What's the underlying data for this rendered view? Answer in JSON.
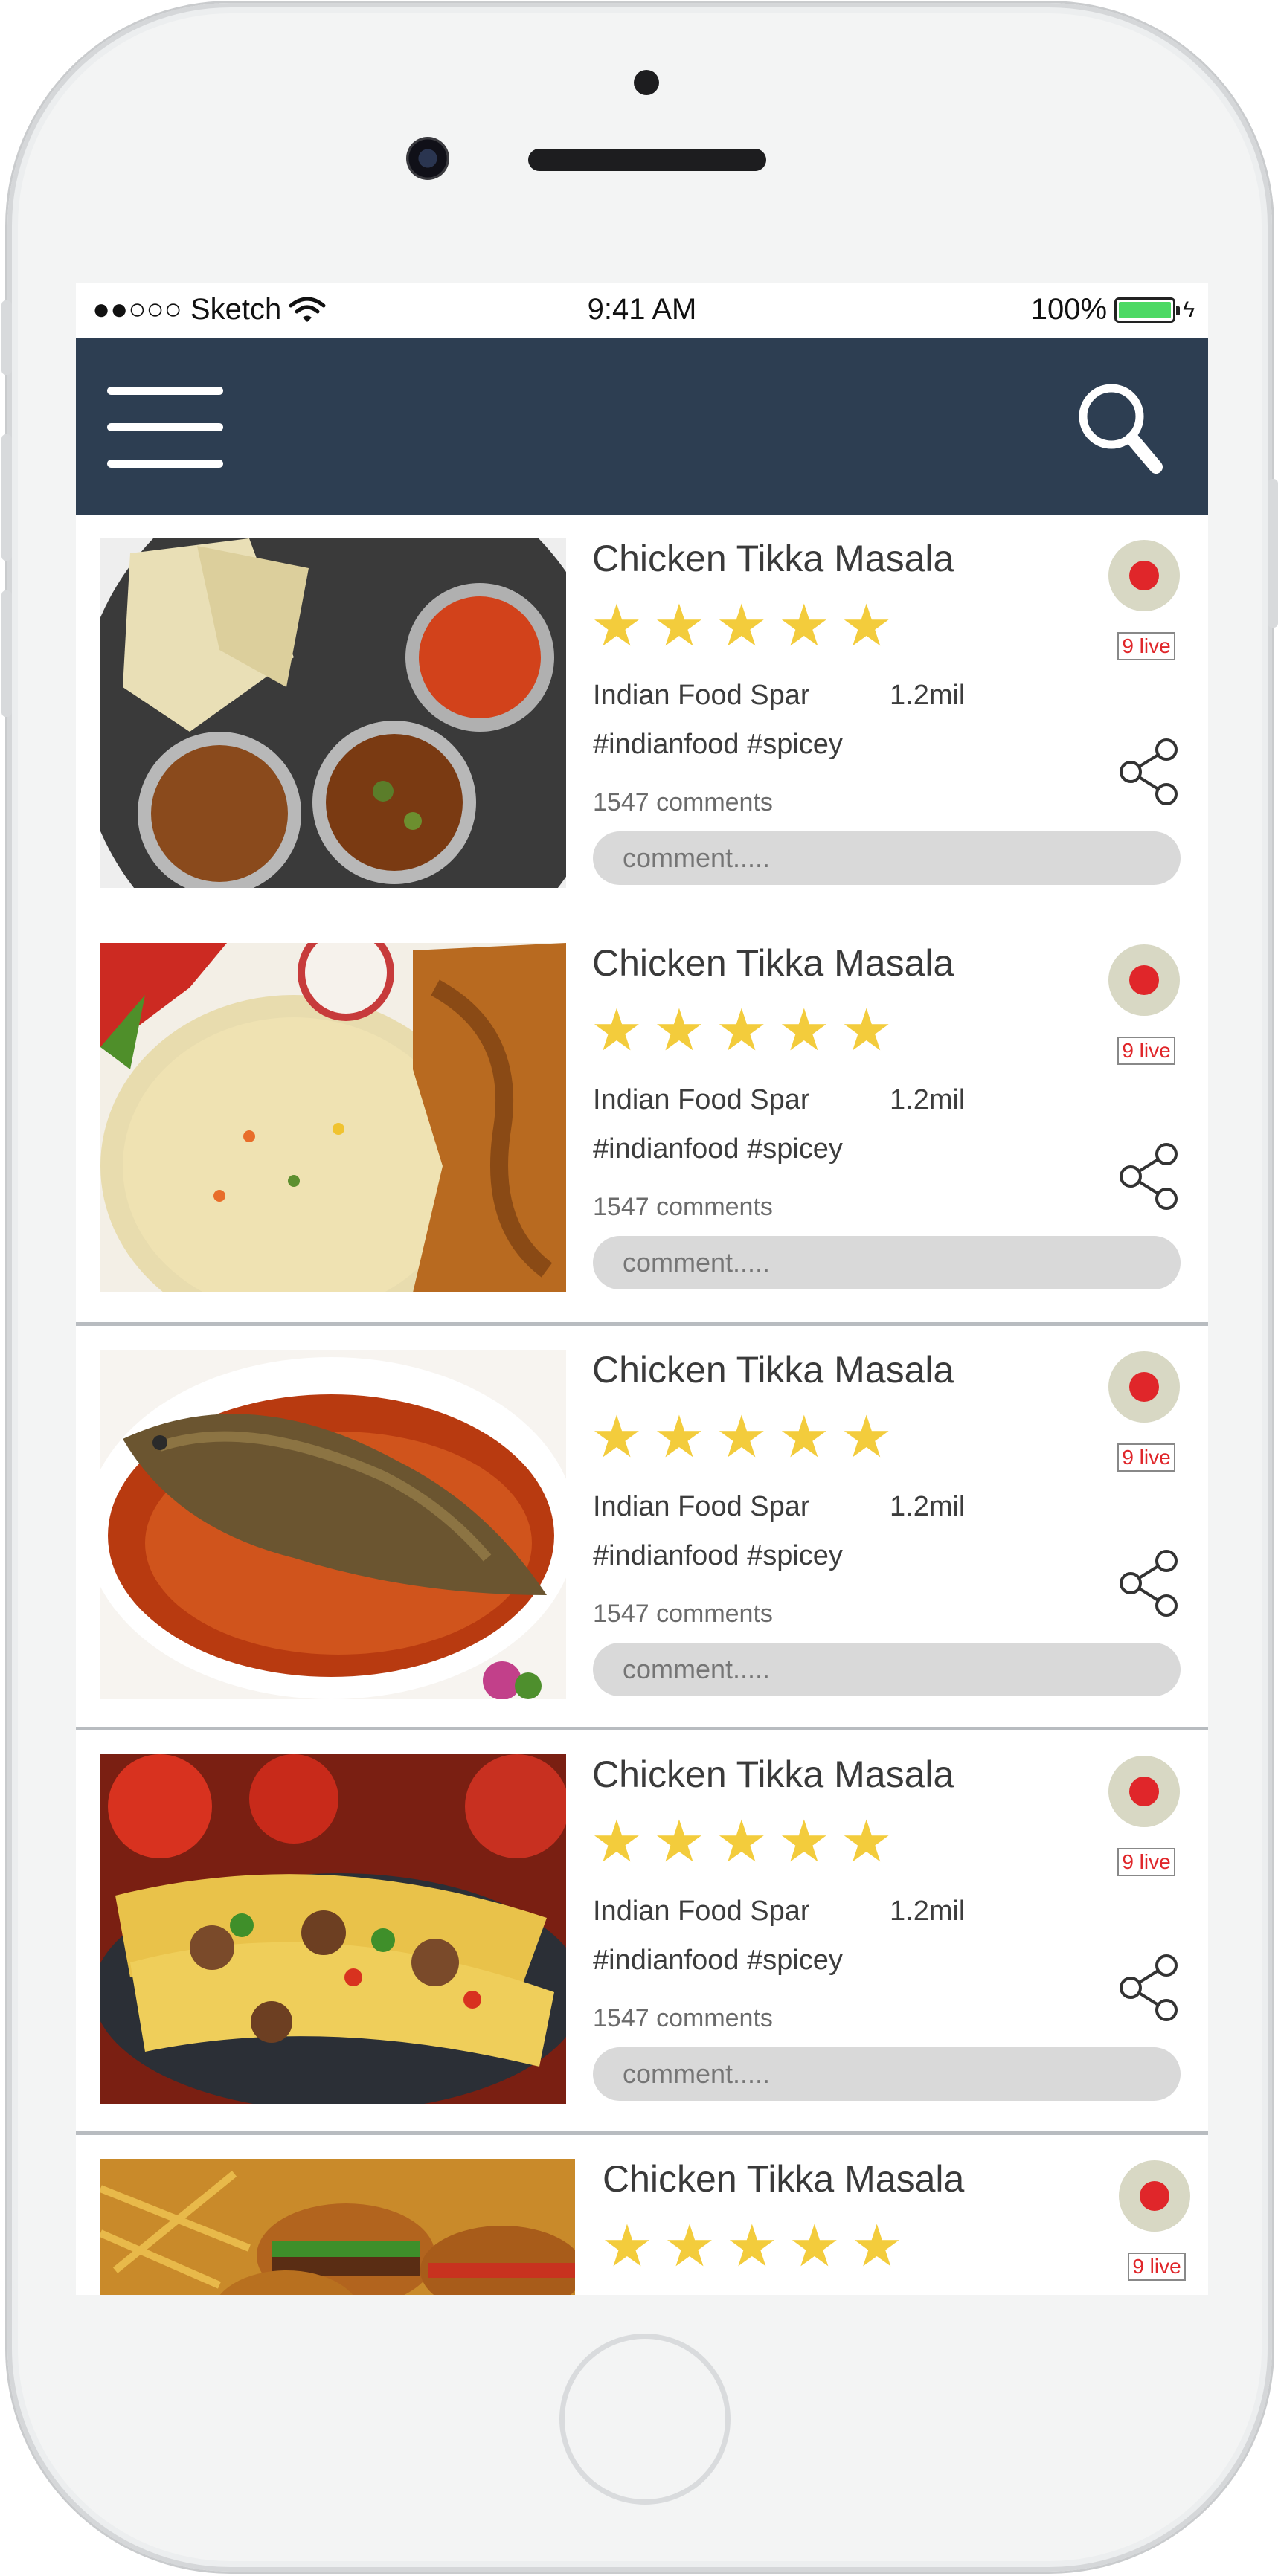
{
  "status_bar": {
    "carrier": "●●○○○ Sketch",
    "time": "9:41 AM",
    "battery_percent": "100%",
    "battery_level": 1.0
  },
  "app_bar": {
    "menu_icon": "hamburger-menu-icon",
    "search_icon": "search-icon",
    "background_color": "#2d3e52"
  },
  "feed": {
    "items": [
      {
        "image": "indian-thali-food-photo",
        "title": "Chicken Tikka Masala",
        "rating": 5,
        "rating_max": 5,
        "channel": "Indian Food Spar",
        "views": "1.2mil",
        "tags": "#indianfood #spicey",
        "comments": "1547 comments",
        "comment_placeholder": "comment.....",
        "live": "9 live"
      },
      {
        "image": "fried-rice-chicken-photo",
        "title": "Chicken Tikka Masala",
        "rating": 5,
        "rating_max": 5,
        "channel": "Indian Food Spar",
        "views": "1.2mil",
        "tags": "#indianfood #spicey",
        "comments": "1547 comments",
        "comment_placeholder": "comment.....",
        "live": "9 live"
      },
      {
        "image": "fish-in-sauce-photo",
        "title": "Chicken Tikka Masala",
        "rating": 5,
        "rating_max": 5,
        "channel": "Indian Food Spar",
        "views": "1.2mil",
        "tags": "#indianfood #spicey",
        "comments": "1547 comments",
        "comment_placeholder": "comment.....",
        "live": "9 live"
      },
      {
        "image": "tacos-photo",
        "title": "Chicken Tikka Masala",
        "rating": 5,
        "rating_max": 5,
        "channel": "Indian Food Spar",
        "views": "1.2mil",
        "tags": "#indianfood #spicey",
        "comments": "1547 comments",
        "comment_placeholder": "comment.....",
        "live": "9 live"
      },
      {
        "image": "burgers-and-fries-photo",
        "title": "Chicken Tikka Masala",
        "rating": 5,
        "rating_max": 5,
        "live": "9 live"
      }
    ]
  },
  "colors": {
    "star": "#f3cc3c",
    "record_dot": "#e0262a",
    "record_ring": "#d8d8c4",
    "comment_box": "#d9d9d9",
    "battery_fill": "#4cd964"
  }
}
